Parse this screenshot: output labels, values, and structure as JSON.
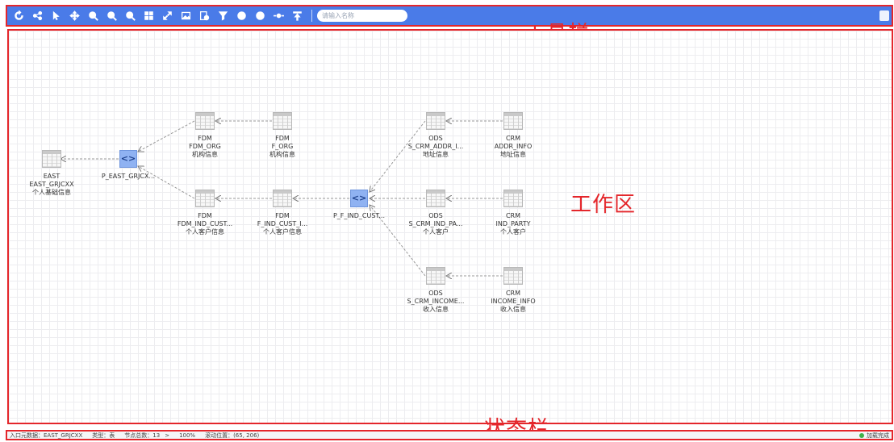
{
  "toolbar": {
    "search_placeholder": "请输入名称",
    "annotation_label": "工具栏",
    "buttons": [
      "refresh-icon",
      "share-icon",
      "pointer-icon",
      "move-icon",
      "zoom-fit-icon",
      "zoom-in-icon",
      "zoom-out-icon",
      "grid-icon",
      "fullscreen-icon",
      "image-icon",
      "export-icon",
      "filter-icon",
      "expand-icon",
      "collapse-icon",
      "center-icon",
      "top-icon"
    ]
  },
  "workarea": {
    "annotation_label": "工作区",
    "nodes": {
      "east": {
        "line1": "EAST",
        "line2": "EAST_GRJCXX",
        "line3": "个人基础信息"
      },
      "p_east": {
        "line1": "P_EAST_GRJCX..."
      },
      "fdm_org": {
        "line1": "FDM",
        "line2": "FDM_ORG",
        "line3": "机构信息"
      },
      "f_org": {
        "line1": "FDM",
        "line2": "F_ORG",
        "line3": "机构信息"
      },
      "fdm_ind": {
        "line1": "FDM",
        "line2": "FDM_IND_CUST...",
        "line3": "个人客户信息"
      },
      "f_ind": {
        "line1": "FDM",
        "line2": "F_IND_CUST_I...",
        "line3": "个人客户信息"
      },
      "p_f_ind": {
        "line1": "P_F_IND_CUST..."
      },
      "ods_addr": {
        "line1": "ODS",
        "line2": "S_CRM_ADDR_I...",
        "line3": "地址信息"
      },
      "crm_addr": {
        "line1": "CRM",
        "line2": "ADDR_INFO",
        "line3": "地址信息"
      },
      "ods_party": {
        "line1": "ODS",
        "line2": "S_CRM_IND_PA...",
        "line3": "个人客户"
      },
      "crm_party": {
        "line1": "CRM",
        "line2": "IND_PARTY",
        "line3": "个人客户"
      },
      "ods_income": {
        "line1": "ODS",
        "line2": "S_CRM_INCOME...",
        "line3": "收入信息"
      },
      "crm_income": {
        "line1": "CRM",
        "line2": "INCOME_INFO",
        "line3": "收入信息"
      }
    }
  },
  "statusbar": {
    "annotation_label": "状态栏",
    "entry": "入口元数据：EAST_GRJCXX",
    "type": "类型：表",
    "node_count": "节点总数：13",
    "arrow": ">",
    "zoom": "100%",
    "scroll": "滚动位置：(65, 206)",
    "status": "加载完成"
  }
}
